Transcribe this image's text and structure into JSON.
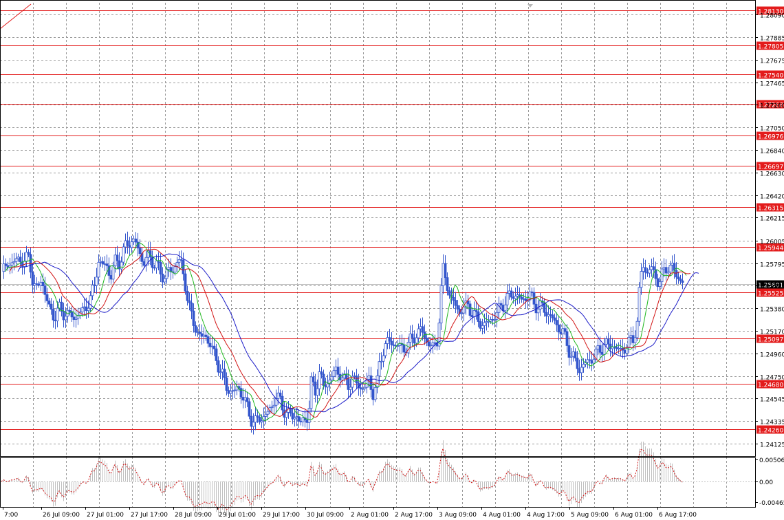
{
  "chart_data": [
    {
      "type": "candlestick",
      "title": "",
      "xlabel": "",
      "ylabel": "",
      "ylim": [
        1.2402,
        1.282
      ],
      "grid": true,
      "y_ticks": [
        "1.28090",
        "1.27885",
        "1.27675",
        "1.27465",
        "1.27260",
        "1.27050",
        "1.26840",
        "1.26630",
        "1.26420",
        "1.26215",
        "1.26005",
        "1.25795",
        "1.25590",
        "1.25380",
        "1.25170",
        "1.24960",
        "1.24750",
        "1.24545",
        "1.24335",
        "1.24125"
      ],
      "x_ticks": [
        "7:00",
        "26 Jul 09:00",
        "27 Jul 01:00",
        "27 Jul 17:00",
        "28 Jul 09:00",
        "29 Jul 01:00",
        "29 Jul 17:00",
        "30 Jul 09:00",
        "2 Aug 01:00",
        "2 Aug 17:00",
        "3 Aug 09:00",
        "4 Aug 01:00",
        "4 Aug 17:00",
        "5 Aug 09:00",
        "6 Aug 01:00",
        "6 Aug 17:00"
      ],
      "current_price": "1.25601",
      "levels": [
        "1.28130",
        "1.27805",
        "1.27540",
        "1.27268",
        "1.26976",
        "1.26697",
        "1.26315",
        "1.25944",
        "1.25525",
        "1.25097",
        "1.24680",
        "1.24260"
      ],
      "colors": {
        "candles": "#3355cc",
        "levels": "#e31b1b",
        "grid": "#9a9a9a",
        "ma_fast": "#1fb81f",
        "ma_mid": "#d21414",
        "ma_slow": "#1b1bc8"
      },
      "close_path": [
        [
          0,
          1.2568
        ],
        [
          6,
          1.2575
        ],
        [
          12,
          1.2578
        ],
        [
          18,
          1.2582
        ],
        [
          24,
          1.258
        ],
        [
          30,
          1.2584
        ],
        [
          36,
          1.2581
        ],
        [
          42,
          1.2585
        ],
        [
          48,
          1.256
        ],
        [
          54,
          1.2555
        ],
        [
          60,
          1.2565
        ],
        [
          66,
          1.255
        ],
        [
          72,
          1.2535
        ],
        [
          78,
          1.253
        ],
        [
          84,
          1.2538
        ],
        [
          90,
          1.2532
        ],
        [
          96,
          1.2535
        ],
        [
          102,
          1.253
        ],
        [
          108,
          1.2528
        ],
        [
          114,
          1.2535
        ],
        [
          120,
          1.2533
        ],
        [
          126,
          1.2542
        ],
        [
          132,
          1.2548
        ],
        [
          138,
          1.256
        ],
        [
          142,
          1.2585
        ],
        [
          148,
          1.2575
        ],
        [
          154,
          1.258
        ],
        [
          160,
          1.2565
        ],
        [
          166,
          1.2582
        ],
        [
          172,
          1.2578
        ],
        [
          178,
          1.259
        ],
        [
          184,
          1.2595
        ],
        [
          190,
          1.2602
        ],
        [
          196,
          1.2598
        ],
        [
          202,
          1.259
        ],
        [
          208,
          1.258
        ],
        [
          214,
          1.2585
        ],
        [
          220,
          1.2583
        ],
        [
          226,
          1.2578
        ],
        [
          232,
          1.2572
        ],
        [
          238,
          1.2565
        ],
        [
          244,
          1.2575
        ],
        [
          250,
          1.2568
        ],
        [
          256,
          1.2585
        ],
        [
          262,
          1.2578
        ],
        [
          268,
          1.2565
        ],
        [
          274,
          1.254
        ],
        [
          280,
          1.2525
        ],
        [
          286,
          1.2518
        ],
        [
          292,
          1.251
        ],
        [
          298,
          1.2512
        ],
        [
          304,
          1.2508
        ],
        [
          310,
          1.2495
        ],
        [
          316,
          1.2488
        ],
        [
          322,
          1.2478
        ],
        [
          328,
          1.2465
        ],
        [
          334,
          1.2462
        ],
        [
          340,
          1.246
        ],
        [
          346,
          1.2465
        ],
        [
          352,
          1.2458
        ],
        [
          358,
          1.2447
        ],
        [
          364,
          1.2437
        ],
        [
          370,
          1.2432
        ],
        [
          376,
          1.2435
        ],
        [
          382,
          1.2438
        ],
        [
          388,
          1.244
        ],
        [
          394,
          1.2445
        ],
        [
          400,
          1.2458
        ],
        [
          406,
          1.2452
        ],
        [
          412,
          1.2445
        ],
        [
          418,
          1.244
        ],
        [
          424,
          1.2438
        ],
        [
          430,
          1.244
        ],
        [
          436,
          1.243
        ],
        [
          442,
          1.2435
        ],
        [
          448,
          1.244
        ],
        [
          452,
          1.2468
        ],
        [
          458,
          1.2462
        ],
        [
          464,
          1.2478
        ],
        [
          470,
          1.2465
        ],
        [
          476,
          1.247
        ],
        [
          482,
          1.2475
        ],
        [
          488,
          1.248
        ],
        [
          494,
          1.2478
        ],
        [
          500,
          1.247
        ],
        [
          506,
          1.2468
        ],
        [
          512,
          1.2473
        ],
        [
          518,
          1.2468
        ],
        [
          524,
          1.2465
        ],
        [
          530,
          1.2465
        ],
        [
          536,
          1.2472
        ],
        [
          542,
          1.246
        ],
        [
          548,
          1.2468
        ],
        [
          552,
          1.2492
        ],
        [
          558,
          1.25
        ],
        [
          564,
          1.2508
        ],
        [
          570,
          1.2505
        ],
        [
          576,
          1.2505
        ],
        [
          582,
          1.25
        ],
        [
          588,
          1.2502
        ],
        [
          594,
          1.2505
        ],
        [
          600,
          1.251
        ],
        [
          606,
          1.2515
        ],
        [
          612,
          1.2518
        ],
        [
          618,
          1.251
        ],
        [
          624,
          1.2505
        ],
        [
          630,
          1.25
        ],
        [
          636,
          1.251
        ],
        [
          640,
          1.255
        ],
        [
          644,
          1.2572
        ],
        [
          650,
          1.256
        ],
        [
          656,
          1.2545
        ],
        [
          662,
          1.254
        ],
        [
          668,
          1.2535
        ],
        [
          674,
          1.2538
        ],
        [
          680,
          1.254
        ],
        [
          686,
          1.2535
        ],
        [
          692,
          1.2528
        ],
        [
          698,
          1.2525
        ],
        [
          704,
          1.2522
        ],
        [
          710,
          1.2525
        ],
        [
          716,
          1.253
        ],
        [
          722,
          1.2532
        ],
        [
          728,
          1.254
        ],
        [
          734,
          1.2545
        ],
        [
          740,
          1.2548
        ],
        [
          746,
          1.2552
        ],
        [
          752,
          1.2548
        ],
        [
          758,
          1.2545
        ],
        [
          764,
          1.2548
        ],
        [
          770,
          1.255
        ],
        [
          776,
          1.2542
        ],
        [
          782,
          1.254
        ],
        [
          788,
          1.2538
        ],
        [
          794,
          1.2535
        ],
        [
          800,
          1.253
        ],
        [
          806,
          1.2525
        ],
        [
          812,
          1.252
        ],
        [
          818,
          1.2515
        ],
        [
          824,
          1.2505
        ],
        [
          830,
          1.2495
        ],
        [
          836,
          1.2488
        ],
        [
          842,
          1.2482
        ],
        [
          848,
          1.2485
        ],
        [
          854,
          1.2488
        ],
        [
          860,
          1.2492
        ],
        [
          866,
          1.2495
        ],
        [
          872,
          1.25
        ],
        [
          878,
          1.2505
        ],
        [
          884,
          1.2502
        ],
        [
          890,
          1.2505
        ],
        [
          896,
          1.25
        ],
        [
          902,
          1.2498
        ],
        [
          908,
          1.2502
        ],
        [
          914,
          1.2505
        ],
        [
          920,
          1.251
        ],
        [
          926,
          1.2525
        ],
        [
          930,
          1.256
        ],
        [
          934,
          1.258
        ],
        [
          940,
          1.257
        ],
        [
          946,
          1.2575
        ],
        [
          952,
          1.2568
        ],
        [
          958,
          1.2562
        ],
        [
          964,
          1.257
        ],
        [
          970,
          1.2578
        ],
        [
          976,
          1.2575
        ],
        [
          982,
          1.257
        ],
        [
          988,
          1.2565
        ],
        [
          994,
          1.256
        ]
      ]
    },
    {
      "type": "bar",
      "title": "",
      "y_ticks": [
        "0.005065",
        "0.00",
        "-0.00465"
      ],
      "colors": {
        "bars": "#c0c0c0",
        "signal": "#d21414"
      }
    }
  ]
}
